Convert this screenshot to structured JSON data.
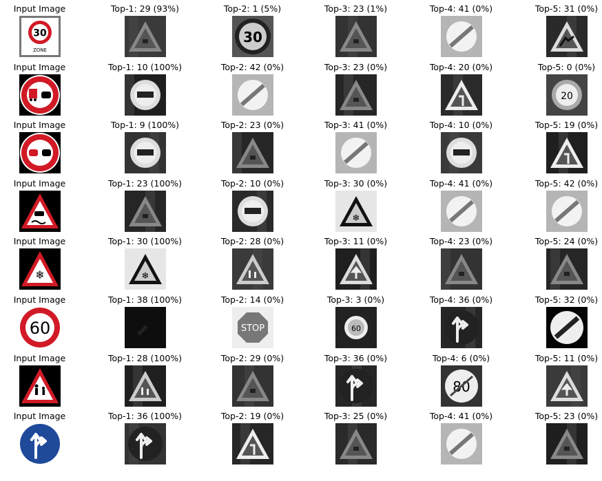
{
  "rows": [
    {
      "cells": [
        {
          "label": "Input Image",
          "kind": "input",
          "icon": "speed-30-zone-sign-icon"
        },
        {
          "label": "Top-1: 29 (93%)",
          "icon": "triangle-warning-icon"
        },
        {
          "label": "Top-2: 1 (5%)",
          "icon": "circle-30-icon"
        },
        {
          "label": "Top-3: 23 (1%)",
          "icon": "triangle-warning-icon"
        },
        {
          "label": "Top-4: 41 (0%)",
          "icon": "end-restriction-icon"
        },
        {
          "label": "Top-5: 31 (0%)",
          "icon": "triangle-animal-icon"
        }
      ]
    },
    {
      "cells": [
        {
          "label": "Input Image",
          "kind": "input",
          "icon": "no-truck-overtaking-sign-icon"
        },
        {
          "label": "Top-1: 10 (100%)",
          "icon": "circle-no-overtaking-icon"
        },
        {
          "label": "Top-2: 42 (0%)",
          "icon": "end-restriction-icon"
        },
        {
          "label": "Top-3: 23 (0%)",
          "icon": "triangle-warning-icon"
        },
        {
          "label": "Top-4: 20 (0%)",
          "icon": "triangle-curve-icon"
        },
        {
          "label": "Top-5: 0 (0%)",
          "icon": "circle-20-icon"
        }
      ]
    },
    {
      "cells": [
        {
          "label": "Input Image",
          "kind": "input",
          "icon": "no-overtaking-sign-icon"
        },
        {
          "label": "Top-1: 9 (100%)",
          "icon": "circle-no-overtaking-icon"
        },
        {
          "label": "Top-2: 23 (0%)",
          "icon": "triangle-warning-icon"
        },
        {
          "label": "Top-3: 41 (0%)",
          "icon": "end-restriction-icon"
        },
        {
          "label": "Top-4: 10 (0%)",
          "icon": "circle-no-overtaking-icon"
        },
        {
          "label": "Top-5: 19 (0%)",
          "icon": "triangle-curve-icon"
        }
      ]
    },
    {
      "cells": [
        {
          "label": "Input Image",
          "kind": "input",
          "icon": "slippery-road-sign-icon"
        },
        {
          "label": "Top-1: 23 (100%)",
          "icon": "triangle-warning-icon"
        },
        {
          "label": "Top-2: 10 (0%)",
          "icon": "circle-no-overtaking-icon"
        },
        {
          "label": "Top-3: 30 (0%)",
          "icon": "triangle-snow-icon"
        },
        {
          "label": "Top-4: 41 (0%)",
          "icon": "end-restriction-icon"
        },
        {
          "label": "Top-5: 42 (0%)",
          "icon": "end-restriction-icon"
        }
      ]
    },
    {
      "cells": [
        {
          "label": "Input Image",
          "kind": "input",
          "icon": "snow-warning-sign-icon"
        },
        {
          "label": "Top-1: 30 (100%)",
          "icon": "triangle-snow-icon"
        },
        {
          "label": "Top-2: 28 (0%)",
          "icon": "triangle-children-icon"
        },
        {
          "label": "Top-3: 11 (0%)",
          "icon": "triangle-arrow-icon"
        },
        {
          "label": "Top-4: 23 (0%)",
          "icon": "triangle-warning-icon"
        },
        {
          "label": "Top-5: 24 (0%)",
          "icon": "triangle-warning-icon"
        }
      ]
    },
    {
      "cells": [
        {
          "label": "Input Image",
          "kind": "input",
          "icon": "speed-60-sign-icon"
        },
        {
          "label": "Top-1: 38 (100%)",
          "icon": "dark-arrow-icon"
        },
        {
          "label": "Top-2: 14 (0%)",
          "icon": "stop-sign-icon"
        },
        {
          "label": "Top-3: 3 (0%)",
          "icon": "circle-60-icon"
        },
        {
          "label": "Top-4: 36 (0%)",
          "icon": "straight-or-right-icon"
        },
        {
          "label": "Top-5: 32 (0%)",
          "icon": "end-all-limits-icon"
        }
      ]
    },
    {
      "cells": [
        {
          "label": "Input Image",
          "kind": "input",
          "icon": "children-crossing-sign-icon"
        },
        {
          "label": "Top-1: 28 (100%)",
          "icon": "triangle-children-icon"
        },
        {
          "label": "Top-2: 29 (0%)",
          "icon": "triangle-warning-icon"
        },
        {
          "label": "Top-3: 36 (0%)",
          "icon": "straight-or-right-icon"
        },
        {
          "label": "Top-4: 6 (0%)",
          "icon": "end-80-icon"
        },
        {
          "label": "Top-5: 11 (0%)",
          "icon": "triangle-arrow-icon"
        }
      ]
    },
    {
      "cells": [
        {
          "label": "Input Image",
          "kind": "input",
          "icon": "go-straight-or-right-sign-icon"
        },
        {
          "label": "Top-1: 36 (100%)",
          "icon": "straight-or-right-icon"
        },
        {
          "label": "Top-2: 19 (0%)",
          "icon": "triangle-curve-icon"
        },
        {
          "label": "Top-3: 25 (0%)",
          "icon": "triangle-warning-icon"
        },
        {
          "label": "Top-4: 41 (0%)",
          "icon": "end-restriction-icon"
        },
        {
          "label": "Top-5: 23 (0%)",
          "icon": "triangle-warning-icon"
        }
      ]
    }
  ],
  "colors": {
    "sign_red": "#d11a26",
    "sign_blue": "#1f4a9a",
    "gray_dark": "#1a1a1a"
  }
}
